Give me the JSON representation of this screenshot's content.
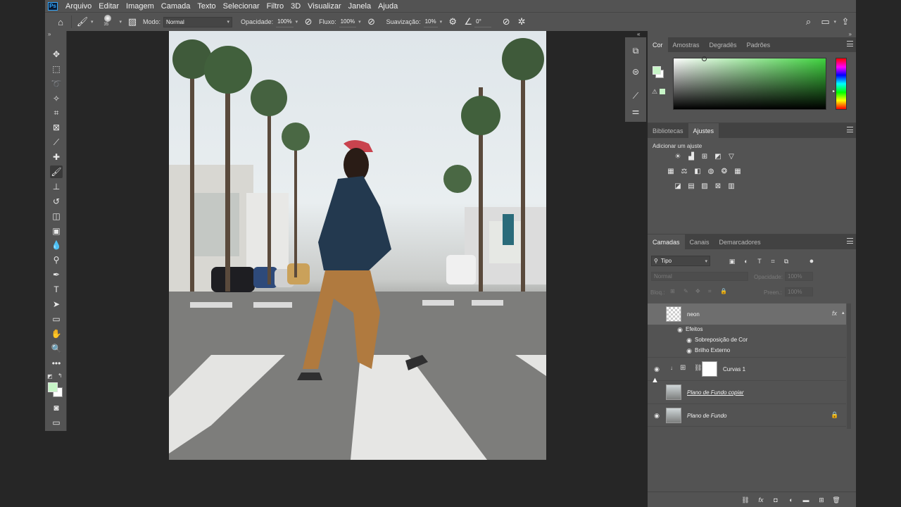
{
  "app": {
    "logo_text": "Ps"
  },
  "menu": [
    "Arquivo",
    "Editar",
    "Imagem",
    "Camada",
    "Texto",
    "Selecionar",
    "Filtro",
    "3D",
    "Visualizar",
    "Janela",
    "Ajuda"
  ],
  "options": {
    "brush_size": "35",
    "mode_label": "Modo:",
    "mode_value": "Normal",
    "opacity_label": "Opacidade:",
    "opacity_value": "100%",
    "flow_label": "Fluxo:",
    "flow_value": "100%",
    "smoothing_label": "Suavização:",
    "smoothing_value": "10%",
    "angle_value": "0°"
  },
  "color_panel": {
    "tabs": [
      "Cor",
      "Amostras",
      "Degradês",
      "Padrões"
    ],
    "active_tab": "Cor",
    "foreground": "#c7f5c7",
    "background": "#ffffff",
    "gradient_hue": "#3fd23f"
  },
  "adjustments_panel": {
    "tabs": [
      "Bibliotecas",
      "Ajustes"
    ],
    "active_tab": "Ajustes",
    "hint": "Adicionar um ajuste"
  },
  "layers_panel": {
    "tabs": [
      "Camadas",
      "Canais",
      "Demarcadores"
    ],
    "active_tab": "Camadas",
    "filter_value": "Tipo",
    "blend_mode": "Normal",
    "opacity_label": "Opacidade:",
    "opacity_value": "100%",
    "lock_label": "Bloq.:",
    "fill_label": "Preen.:",
    "fill_value": "100%",
    "layers": {
      "neon": {
        "name": "neon",
        "fx": "fx",
        "effects_label": "Efeitos",
        "effect_1": "Sobreposição de Cor",
        "effect_2": "Brilho Externo"
      },
      "curves": {
        "name": "Curvas 1"
      },
      "bg_copy": {
        "name": "Plano de Fundo copiar"
      },
      "bg": {
        "name": "Plano de Fundo"
      }
    }
  }
}
